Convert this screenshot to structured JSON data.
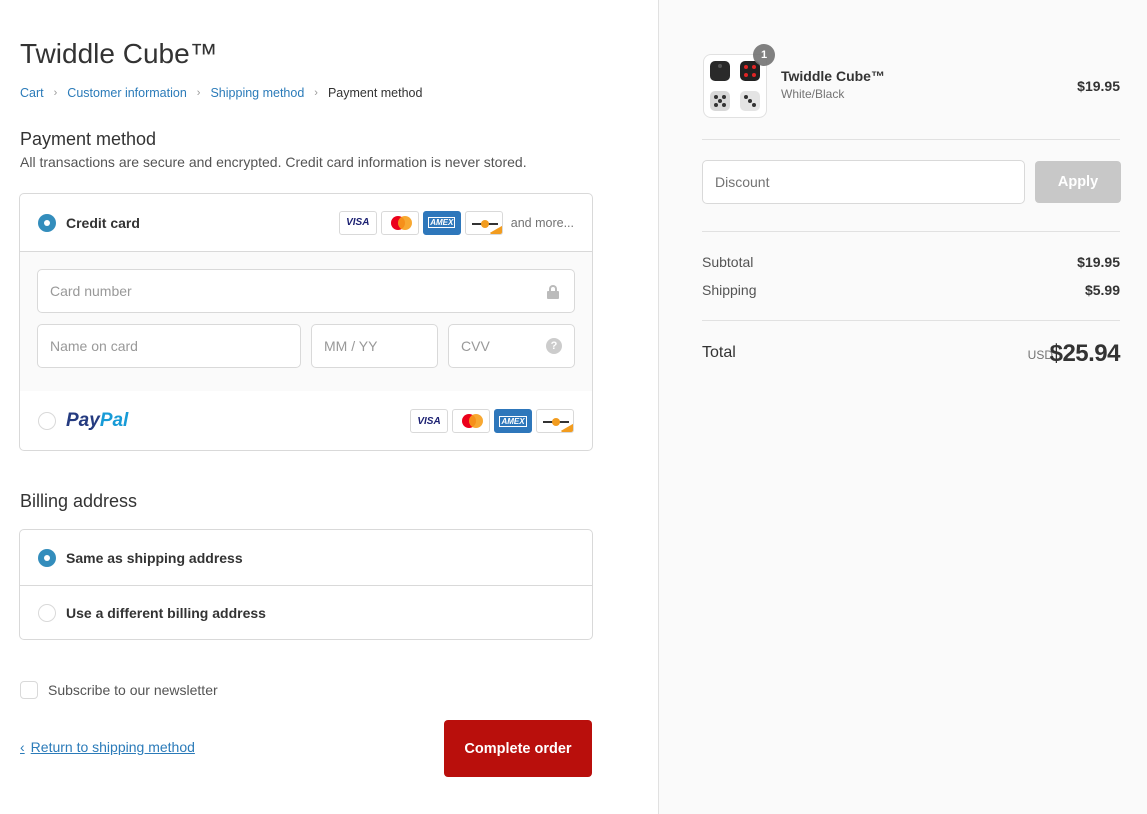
{
  "shop": {
    "title": "Twiddle Cube™"
  },
  "breadcrumb": {
    "items": [
      "Cart",
      "Customer information",
      "Shipping method"
    ],
    "current": "Payment method",
    "separator": "›"
  },
  "payment": {
    "title": "Payment method",
    "subtitle": "All transactions are secure and encrypted. Credit card information is never stored.",
    "credit_card": {
      "label": "Credit card",
      "selected": true,
      "and_more": "and more...",
      "card_icons": [
        "visa-icon",
        "mastercard-icon",
        "amex-icon",
        "discover-icon"
      ],
      "fields": {
        "card_number_placeholder": "Card number",
        "name_placeholder": "Name on card",
        "expiry_placeholder": "MM / YY",
        "cvv_placeholder": "CVV",
        "cvv_help": "?"
      }
    },
    "paypal": {
      "logo_pay": "Pay",
      "logo_pal": "Pal",
      "selected": false
    },
    "card_text": {
      "visa": "VISA",
      "amex": "AMEX"
    }
  },
  "billing": {
    "title": "Billing address",
    "options": [
      {
        "label": "Same as shipping address",
        "selected": true
      },
      {
        "label": "Use a different billing address",
        "selected": false
      }
    ]
  },
  "newsletter": {
    "label": "Subscribe to our newsletter",
    "checked": false
  },
  "footer": {
    "return_label": "Return to shipping method",
    "return_chevron": "‹",
    "complete_label": "Complete order"
  },
  "order": {
    "product": {
      "name": "Twiddle Cube™",
      "variant": "White/Black",
      "price": "$19.95",
      "quantity": "1"
    },
    "discount": {
      "placeholder": "Discount",
      "apply_label": "Apply"
    },
    "subtotal": {
      "label": "Subtotal",
      "value": "$19.95"
    },
    "shipping": {
      "label": "Shipping",
      "value": "$5.99"
    },
    "total": {
      "label": "Total",
      "currency": "USD",
      "value": "$25.94"
    }
  },
  "colors": {
    "accent": "#338dbc",
    "link": "#2b7bb9",
    "complete_button": "#b90f0c",
    "apply_button_disabled": "#c8c8c8"
  }
}
